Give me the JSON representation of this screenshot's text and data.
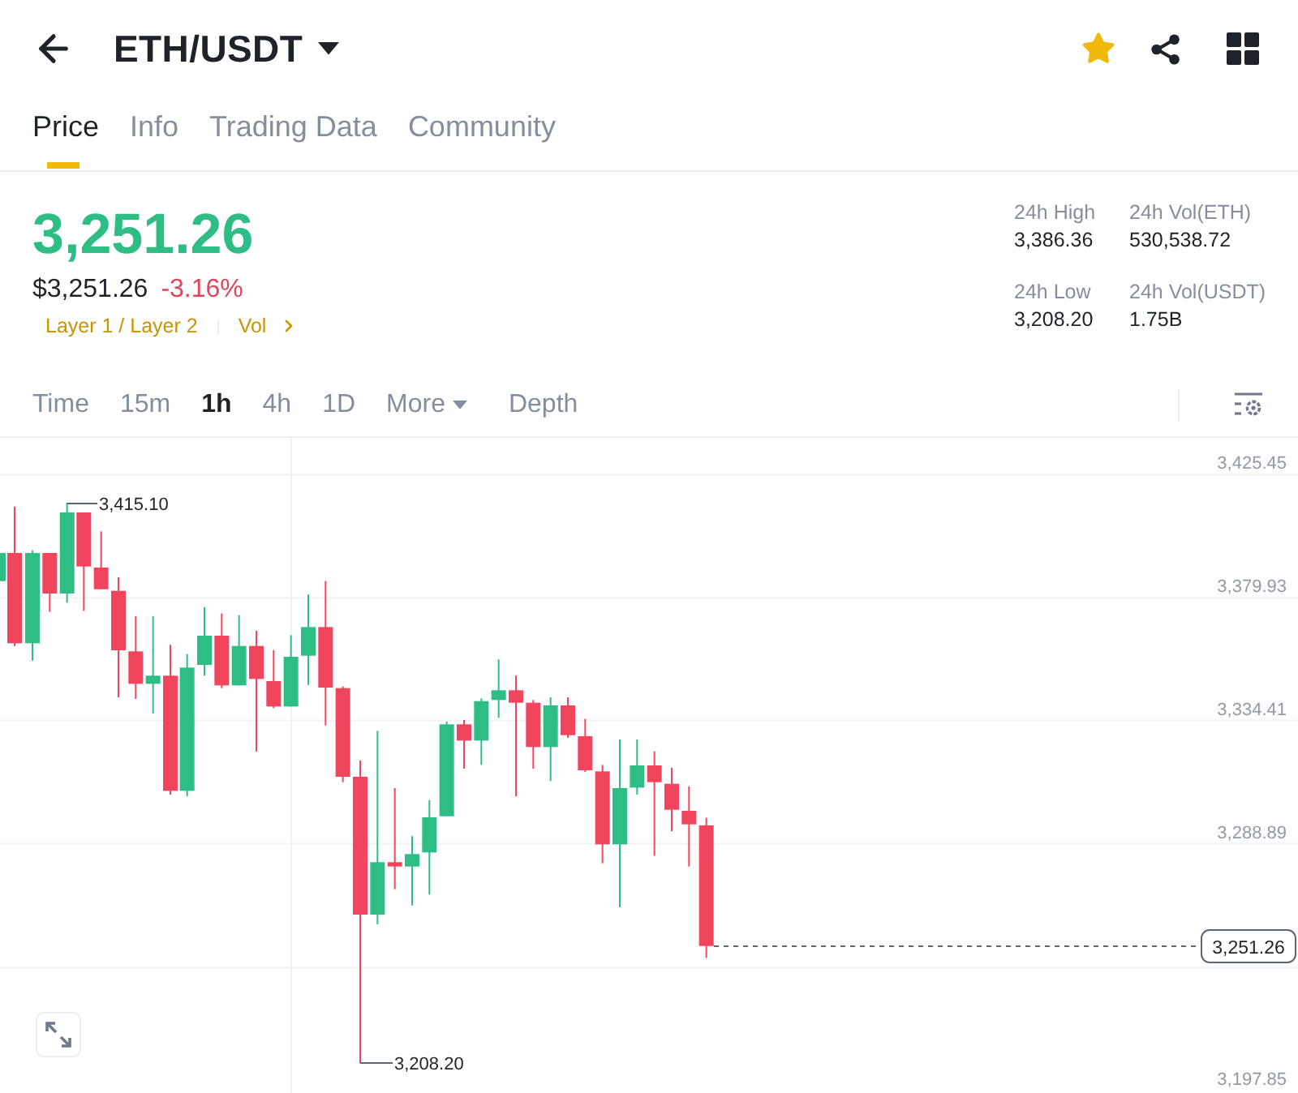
{
  "header": {
    "title": "ETH/USDT",
    "favorite": true
  },
  "tabs": [
    {
      "label": "Price",
      "selected": true
    },
    {
      "label": "Info",
      "selected": false
    },
    {
      "label": "Trading Data",
      "selected": false
    },
    {
      "label": "Community",
      "selected": false
    }
  ],
  "price": {
    "last": "3,251.26",
    "fiat": "$3,251.26",
    "change": "-3.16%",
    "category": "Layer 1 / Layer 2",
    "vol_link": "Vol"
  },
  "stats": [
    {
      "label": "24h High",
      "value": "3,386.36"
    },
    {
      "label": "24h Vol(ETH)",
      "value": "530,538.72"
    },
    {
      "label": "24h Low",
      "value": "3,208.20"
    },
    {
      "label": "24h Vol(USDT)",
      "value": "1.75B"
    }
  ],
  "intervals": [
    {
      "label": "Time",
      "kind": "option",
      "selected": false
    },
    {
      "label": "15m",
      "kind": "option",
      "selected": false
    },
    {
      "label": "1h",
      "kind": "option",
      "selected": true
    },
    {
      "label": "4h",
      "kind": "option",
      "selected": false
    },
    {
      "label": "1D",
      "kind": "option",
      "selected": false
    },
    {
      "label": "More",
      "kind": "dropdown",
      "selected": false
    },
    {
      "label": "Depth",
      "kind": "option",
      "selected": false
    }
  ],
  "chart": {
    "price_axis": [
      "3,425.45",
      "3,379.93",
      "3,334.41",
      "3,288.89",
      "3,197.85"
    ],
    "last_price": "3,251.26",
    "high_marker": "3,415.10",
    "low_marker": "3,208.20"
  }
}
